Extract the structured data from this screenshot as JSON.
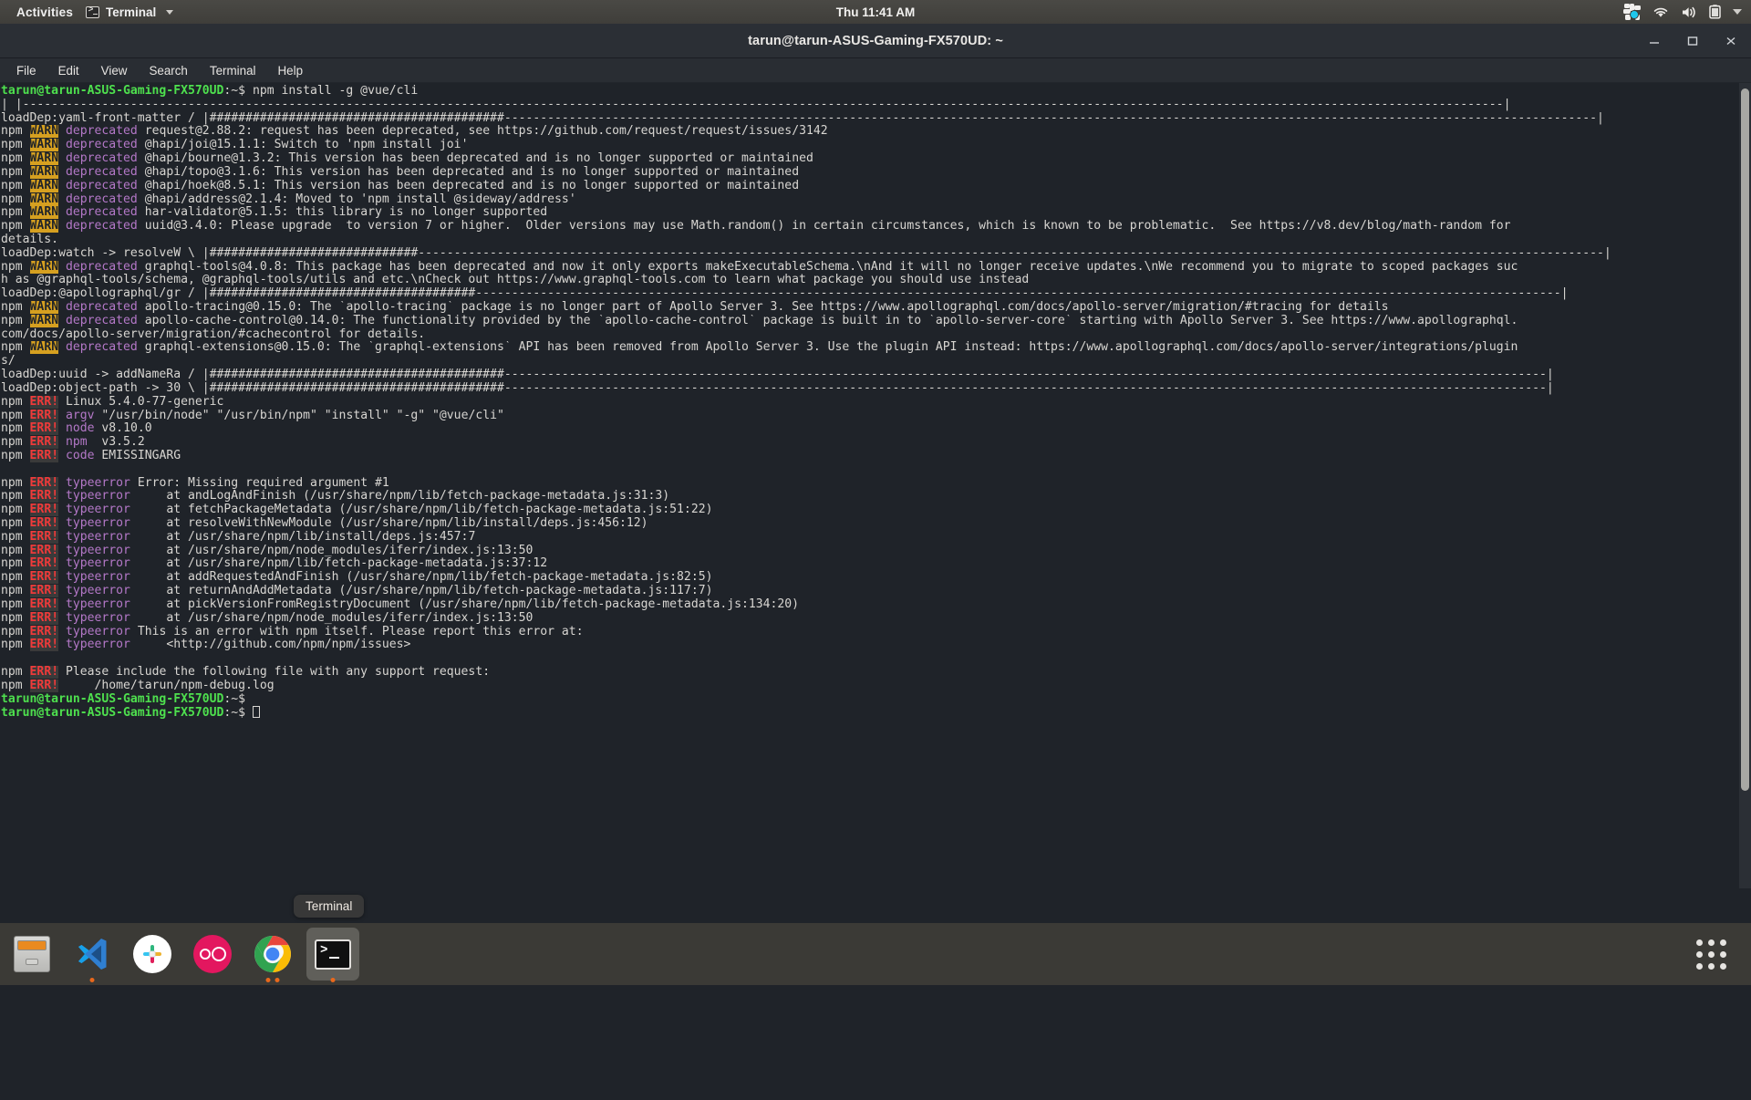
{
  "topbar": {
    "activities": "Activities",
    "app_name": "Terminal",
    "clock": "Thu 11:41 AM",
    "app_icon": "terminal-icon",
    "caret_icon": "chevron-down-icon",
    "tray_icons": [
      "pinwheel-icon",
      "wifi-icon",
      "volume-icon",
      "battery-icon",
      "chevron-down-icon"
    ]
  },
  "window": {
    "title": "tarun@tarun-ASUS-Gaming-FX570UD: ~",
    "minimize_label": "Minimize",
    "maximize_label": "Maximize",
    "close_label": "Close",
    "menu": [
      "File",
      "Edit",
      "View",
      "Search",
      "Terminal",
      "Help"
    ]
  },
  "terminal": {
    "prompt": "tarun@tarun-ASUS-Gaming-FX570UD",
    "prompt_suffix": ":~$ ",
    "colors": {
      "background": "#1f2329",
      "foreground": "#d6d3cf",
      "prompt_green": "#4ee04e",
      "warn_badge": "#d6a020",
      "err_badge_text": "#ef3a3a",
      "magenta": "#b478c8"
    },
    "lines": [
      [
        {
          "t": "tarun@tarun-ASUS-Gaming-FX570UD",
          "c": "c-green"
        },
        {
          "t": ":~$ ",
          "c": "c-white"
        },
        {
          "t": "npm install -g @vue/cli",
          "c": "c-white"
        }
      ],
      [
        {
          "t": "| |--------------------------------------------------------------------------------------------------------------------------------------------------------------------------------------------------------------|",
          "c": "c-white"
        }
      ],
      [
        {
          "t": "loadDep:yaml-front-matter / |#########################################--------------------------------------------------------------------------------------------------------------------------------------------------------|",
          "c": "c-white"
        }
      ],
      [
        {
          "t": "npm ",
          "c": "c-white"
        },
        {
          "t": "WARN",
          "c": "c-warn"
        },
        {
          "t": " ",
          "c": "c-white"
        },
        {
          "t": "deprecated",
          "c": "c-magenta"
        },
        {
          "t": " request@2.88.2: request has been deprecated, see https://github.com/request/request/issues/3142",
          "c": "c-white"
        }
      ],
      [
        {
          "t": "npm ",
          "c": "c-white"
        },
        {
          "t": "WARN",
          "c": "c-warn"
        },
        {
          "t": " ",
          "c": "c-white"
        },
        {
          "t": "deprecated",
          "c": "c-magenta"
        },
        {
          "t": " @hapi/joi@15.1.1: Switch to 'npm install joi'",
          "c": "c-white"
        }
      ],
      [
        {
          "t": "npm ",
          "c": "c-white"
        },
        {
          "t": "WARN",
          "c": "c-warn"
        },
        {
          "t": " ",
          "c": "c-white"
        },
        {
          "t": "deprecated",
          "c": "c-magenta"
        },
        {
          "t": " @hapi/bourne@1.3.2: This version has been deprecated and is no longer supported or maintained",
          "c": "c-white"
        }
      ],
      [
        {
          "t": "npm ",
          "c": "c-white"
        },
        {
          "t": "WARN",
          "c": "c-warn"
        },
        {
          "t": " ",
          "c": "c-white"
        },
        {
          "t": "deprecated",
          "c": "c-magenta"
        },
        {
          "t": " @hapi/topo@3.1.6: This version has been deprecated and is no longer supported or maintained",
          "c": "c-white"
        }
      ],
      [
        {
          "t": "npm ",
          "c": "c-white"
        },
        {
          "t": "WARN",
          "c": "c-warn"
        },
        {
          "t": " ",
          "c": "c-white"
        },
        {
          "t": "deprecated",
          "c": "c-magenta"
        },
        {
          "t": " @hapi/hoek@8.5.1: This version has been deprecated and is no longer supported or maintained",
          "c": "c-white"
        }
      ],
      [
        {
          "t": "npm ",
          "c": "c-white"
        },
        {
          "t": "WARN",
          "c": "c-warn"
        },
        {
          "t": " ",
          "c": "c-white"
        },
        {
          "t": "deprecated",
          "c": "c-magenta"
        },
        {
          "t": " @hapi/address@2.1.4: Moved to 'npm install @sideway/address'",
          "c": "c-white"
        }
      ],
      [
        {
          "t": "npm ",
          "c": "c-white"
        },
        {
          "t": "WARN",
          "c": "c-warn"
        },
        {
          "t": " ",
          "c": "c-white"
        },
        {
          "t": "deprecated",
          "c": "c-magenta"
        },
        {
          "t": " har-validator@5.1.5: this library is no longer supported",
          "c": "c-white"
        }
      ],
      [
        {
          "t": "npm ",
          "c": "c-white"
        },
        {
          "t": "WARN",
          "c": "c-warn"
        },
        {
          "t": " ",
          "c": "c-white"
        },
        {
          "t": "deprecated",
          "c": "c-magenta"
        },
        {
          "t": " uuid@3.4.0: Please upgrade  to version 7 or higher.  Older versions may use Math.random() in certain circumstances, which is known to be problematic.  See https://v8.dev/blog/math-random for",
          "c": "c-white"
        }
      ],
      [
        {
          "t": "details.",
          "c": "c-white"
        }
      ],
      [
        {
          "t": "loadDep:watch -> resolveW \\ |#############################---------------------------------------------------------------------------------------------------------------------------------------------------------------------|",
          "c": "c-white"
        }
      ],
      [
        {
          "t": "npm ",
          "c": "c-white"
        },
        {
          "t": "WARN",
          "c": "c-warn"
        },
        {
          "t": " ",
          "c": "c-white"
        },
        {
          "t": "deprecated",
          "c": "c-magenta"
        },
        {
          "t": " graphql-tools@4.0.8: This package has been deprecated and now it only exports makeExecutableSchema.\\nAnd it will no longer receive updates.\\nWe recommend you to migrate to scoped packages suc",
          "c": "c-white"
        }
      ],
      [
        {
          "t": "h as @graphql-tools/schema, @graphql-tools/utils and etc.\\nCheck out https://www.graphql-tools.com to learn what package you should use instead",
          "c": "c-white"
        }
      ],
      [
        {
          "t": "loadDep:@apollographql/gr / |#####################################-------------------------------------------------------------------------------------------------------------------------------------------------------|",
          "c": "c-white"
        }
      ],
      [
        {
          "t": "npm ",
          "c": "c-white"
        },
        {
          "t": "WARN",
          "c": "c-warn"
        },
        {
          "t": " ",
          "c": "c-white"
        },
        {
          "t": "deprecated",
          "c": "c-magenta"
        },
        {
          "t": " apollo-tracing@0.15.0: The `apollo-tracing` package is no longer part of Apollo Server 3. See https://www.apollographql.com/docs/apollo-server/migration/#tracing for details",
          "c": "c-white"
        }
      ],
      [
        {
          "t": "npm ",
          "c": "c-white"
        },
        {
          "t": "WARN",
          "c": "c-warn"
        },
        {
          "t": " ",
          "c": "c-white"
        },
        {
          "t": "deprecated",
          "c": "c-magenta"
        },
        {
          "t": " apollo-cache-control@0.14.0: The functionality provided by the `apollo-cache-control` package is built in to `apollo-server-core` starting with Apollo Server 3. See https://www.apollographql.",
          "c": "c-white"
        }
      ],
      [
        {
          "t": "com/docs/apollo-server/migration/#cachecontrol for details.",
          "c": "c-white"
        }
      ],
      [
        {
          "t": "npm ",
          "c": "c-white"
        },
        {
          "t": "WARN",
          "c": "c-warn"
        },
        {
          "t": " ",
          "c": "c-white"
        },
        {
          "t": "deprecated",
          "c": "c-magenta"
        },
        {
          "t": " graphql-extensions@0.15.0: The `graphql-extensions` API has been removed from Apollo Server 3. Use the plugin API instead: https://www.apollographql.com/docs/apollo-server/integrations/plugin",
          "c": "c-white"
        }
      ],
      [
        {
          "t": "s/",
          "c": "c-white"
        }
      ],
      [
        {
          "t": "loadDep:uuid -> addNameRa / |#########################################-------------------------------------------------------------------------------------------------------------------------------------------------|",
          "c": "c-white"
        }
      ],
      [
        {
          "t": "loadDep:object-path -> 30 \\ |#########################################-------------------------------------------------------------------------------------------------------------------------------------------------|",
          "c": "c-white"
        }
      ],
      [
        {
          "t": "npm ",
          "c": "c-white"
        },
        {
          "t": "ERR!",
          "c": "c-err"
        },
        {
          "t": " Linux 5.4.0-77-generic",
          "c": "c-white"
        }
      ],
      [
        {
          "t": "npm ",
          "c": "c-white"
        },
        {
          "t": "ERR!",
          "c": "c-err"
        },
        {
          "t": " ",
          "c": "c-white"
        },
        {
          "t": "argv",
          "c": "c-magenta"
        },
        {
          "t": " \"/usr/bin/node\" \"/usr/bin/npm\" \"install\" \"-g\" \"@vue/cli\"",
          "c": "c-white"
        }
      ],
      [
        {
          "t": "npm ",
          "c": "c-white"
        },
        {
          "t": "ERR!",
          "c": "c-err"
        },
        {
          "t": " ",
          "c": "c-white"
        },
        {
          "t": "node",
          "c": "c-magenta"
        },
        {
          "t": " v8.10.0",
          "c": "c-white"
        }
      ],
      [
        {
          "t": "npm ",
          "c": "c-white"
        },
        {
          "t": "ERR!",
          "c": "c-err"
        },
        {
          "t": " ",
          "c": "c-white"
        },
        {
          "t": "npm",
          "c": "c-magenta"
        },
        {
          "t": "  v3.5.2",
          "c": "c-white"
        }
      ],
      [
        {
          "t": "npm ",
          "c": "c-white"
        },
        {
          "t": "ERR!",
          "c": "c-err"
        },
        {
          "t": " ",
          "c": "c-white"
        },
        {
          "t": "code",
          "c": "c-magenta"
        },
        {
          "t": " EMISSINGARG",
          "c": "c-white"
        }
      ],
      [
        {
          "t": "",
          "c": "c-white"
        }
      ],
      [
        {
          "t": "npm ",
          "c": "c-white"
        },
        {
          "t": "ERR!",
          "c": "c-err"
        },
        {
          "t": " ",
          "c": "c-white"
        },
        {
          "t": "typeerror",
          "c": "c-magenta"
        },
        {
          "t": " Error: Missing required argument #1",
          "c": "c-white"
        }
      ],
      [
        {
          "t": "npm ",
          "c": "c-white"
        },
        {
          "t": "ERR!",
          "c": "c-err"
        },
        {
          "t": " ",
          "c": "c-white"
        },
        {
          "t": "typeerror",
          "c": "c-magenta"
        },
        {
          "t": "     at andLogAndFinish (/usr/share/npm/lib/fetch-package-metadata.js:31:3)",
          "c": "c-white"
        }
      ],
      [
        {
          "t": "npm ",
          "c": "c-white"
        },
        {
          "t": "ERR!",
          "c": "c-err"
        },
        {
          "t": " ",
          "c": "c-white"
        },
        {
          "t": "typeerror",
          "c": "c-magenta"
        },
        {
          "t": "     at fetchPackageMetadata (/usr/share/npm/lib/fetch-package-metadata.js:51:22)",
          "c": "c-white"
        }
      ],
      [
        {
          "t": "npm ",
          "c": "c-white"
        },
        {
          "t": "ERR!",
          "c": "c-err"
        },
        {
          "t": " ",
          "c": "c-white"
        },
        {
          "t": "typeerror",
          "c": "c-magenta"
        },
        {
          "t": "     at resolveWithNewModule (/usr/share/npm/lib/install/deps.js:456:12)",
          "c": "c-white"
        }
      ],
      [
        {
          "t": "npm ",
          "c": "c-white"
        },
        {
          "t": "ERR!",
          "c": "c-err"
        },
        {
          "t": " ",
          "c": "c-white"
        },
        {
          "t": "typeerror",
          "c": "c-magenta"
        },
        {
          "t": "     at /usr/share/npm/lib/install/deps.js:457:7",
          "c": "c-white"
        }
      ],
      [
        {
          "t": "npm ",
          "c": "c-white"
        },
        {
          "t": "ERR!",
          "c": "c-err"
        },
        {
          "t": " ",
          "c": "c-white"
        },
        {
          "t": "typeerror",
          "c": "c-magenta"
        },
        {
          "t": "     at /usr/share/npm/node_modules/iferr/index.js:13:50",
          "c": "c-white"
        }
      ],
      [
        {
          "t": "npm ",
          "c": "c-white"
        },
        {
          "t": "ERR!",
          "c": "c-err"
        },
        {
          "t": " ",
          "c": "c-white"
        },
        {
          "t": "typeerror",
          "c": "c-magenta"
        },
        {
          "t": "     at /usr/share/npm/lib/fetch-package-metadata.js:37:12",
          "c": "c-white"
        }
      ],
      [
        {
          "t": "npm ",
          "c": "c-white"
        },
        {
          "t": "ERR!",
          "c": "c-err"
        },
        {
          "t": " ",
          "c": "c-white"
        },
        {
          "t": "typeerror",
          "c": "c-magenta"
        },
        {
          "t": "     at addRequestedAndFinish (/usr/share/npm/lib/fetch-package-metadata.js:82:5)",
          "c": "c-white"
        }
      ],
      [
        {
          "t": "npm ",
          "c": "c-white"
        },
        {
          "t": "ERR!",
          "c": "c-err"
        },
        {
          "t": " ",
          "c": "c-white"
        },
        {
          "t": "typeerror",
          "c": "c-magenta"
        },
        {
          "t": "     at returnAndAddMetadata (/usr/share/npm/lib/fetch-package-metadata.js:117:7)",
          "c": "c-white"
        }
      ],
      [
        {
          "t": "npm ",
          "c": "c-white"
        },
        {
          "t": "ERR!",
          "c": "c-err"
        },
        {
          "t": " ",
          "c": "c-white"
        },
        {
          "t": "typeerror",
          "c": "c-magenta"
        },
        {
          "t": "     at pickVersionFromRegistryDocument (/usr/share/npm/lib/fetch-package-metadata.js:134:20)",
          "c": "c-white"
        }
      ],
      [
        {
          "t": "npm ",
          "c": "c-white"
        },
        {
          "t": "ERR!",
          "c": "c-err"
        },
        {
          "t": " ",
          "c": "c-white"
        },
        {
          "t": "typeerror",
          "c": "c-magenta"
        },
        {
          "t": "     at /usr/share/npm/node_modules/iferr/index.js:13:50",
          "c": "c-white"
        }
      ],
      [
        {
          "t": "npm ",
          "c": "c-white"
        },
        {
          "t": "ERR!",
          "c": "c-err"
        },
        {
          "t": " ",
          "c": "c-white"
        },
        {
          "t": "typeerror",
          "c": "c-magenta"
        },
        {
          "t": " This is an error with npm itself. Please report this error at:",
          "c": "c-white"
        }
      ],
      [
        {
          "t": "npm ",
          "c": "c-white"
        },
        {
          "t": "ERR!",
          "c": "c-err"
        },
        {
          "t": " ",
          "c": "c-white"
        },
        {
          "t": "typeerror",
          "c": "c-magenta"
        },
        {
          "t": "     <http://github.com/npm/npm/issues>",
          "c": "c-white"
        }
      ],
      [
        {
          "t": "",
          "c": "c-white"
        }
      ],
      [
        {
          "t": "npm ",
          "c": "c-white"
        },
        {
          "t": "ERR!",
          "c": "c-err"
        },
        {
          "t": " Please include the following file with any support request:",
          "c": "c-white"
        }
      ],
      [
        {
          "t": "npm ",
          "c": "c-white"
        },
        {
          "t": "ERR!",
          "c": "c-err"
        },
        {
          "t": "     /home/tarun/npm-debug.log",
          "c": "c-white"
        }
      ],
      [
        {
          "t": "tarun@tarun-ASUS-Gaming-FX570UD",
          "c": "c-green"
        },
        {
          "t": ":~$ ",
          "c": "c-white"
        }
      ],
      [
        {
          "t": "tarun@tarun-ASUS-Gaming-FX570UD",
          "c": "c-green"
        },
        {
          "t": ":~$ ",
          "c": "c-white"
        },
        {
          "t": "",
          "c": "cursor"
        }
      ]
    ]
  },
  "dock": {
    "tooltip": "Terminal",
    "items": [
      {
        "name": "files",
        "label": "Files",
        "icon": "files-icon",
        "running": false
      },
      {
        "name": "vscode",
        "label": "Visual Studio Code",
        "icon": "vscode-icon",
        "running": true
      },
      {
        "name": "slack",
        "label": "Slack",
        "icon": "slack-icon",
        "running": false
      },
      {
        "name": "oo",
        "label": "OO",
        "icon": "oo-icon",
        "running": false
      },
      {
        "name": "chrome",
        "label": "Google Chrome",
        "icon": "chrome-icon",
        "running": true,
        "instances": 2
      },
      {
        "name": "terminal",
        "label": "Terminal",
        "icon": "terminal-icon",
        "running": true,
        "active": true
      }
    ],
    "app_grid_label": "Show Applications"
  }
}
